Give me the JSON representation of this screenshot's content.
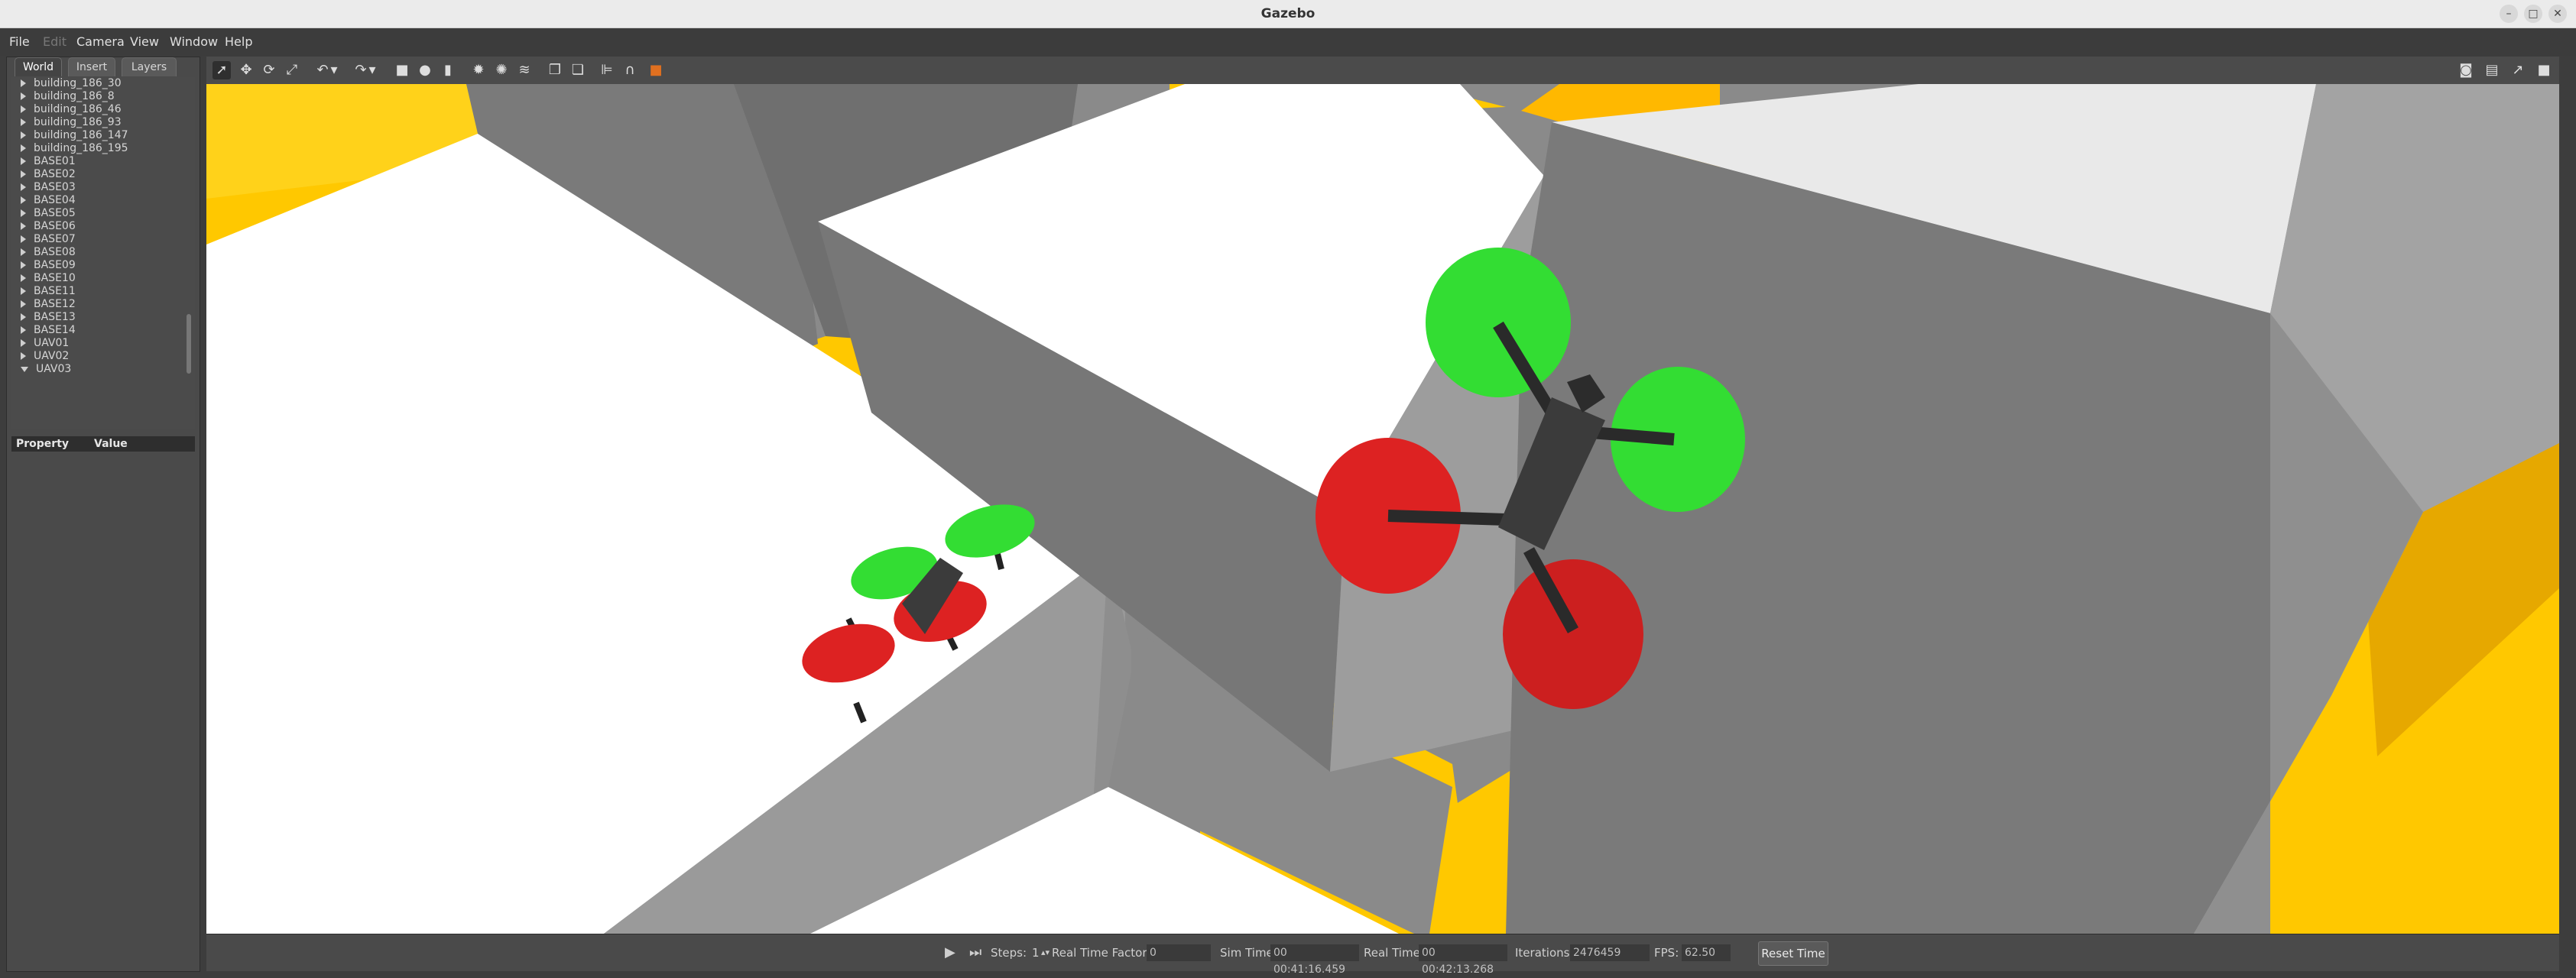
{
  "window": {
    "title": "Gazebo"
  },
  "menu": [
    {
      "label": "File",
      "enabled": true
    },
    {
      "label": "Edit",
      "enabled": false
    },
    {
      "label": "Camera",
      "enabled": true
    },
    {
      "label": "View",
      "enabled": true
    },
    {
      "label": "Window",
      "enabled": true
    },
    {
      "label": "Help",
      "enabled": true
    }
  ],
  "panel": {
    "tabs": [
      "World",
      "Insert",
      "Layers"
    ],
    "active_tab": "World",
    "tree": [
      "building_186_30",
      "building_186_8",
      "building_186_46",
      "building_186_93",
      "building_186_147",
      "building_186_195",
      "BASE01",
      "BASE02",
      "BASE03",
      "BASE04",
      "BASE05",
      "BASE06",
      "BASE07",
      "BASE08",
      "BASE09",
      "BASE10",
      "BASE11",
      "BASE12",
      "BASE13",
      "BASE14",
      "UAV01",
      "UAV02",
      "UAV03"
    ],
    "expanded": "UAV03",
    "property_header": {
      "property": "Property",
      "value": "Value"
    }
  },
  "toolbar": {
    "tools": [
      "select-arrow-icon",
      "translate-icon",
      "rotate-icon",
      "scale-icon",
      "undo-icon",
      "undo-dropdown-icon",
      "redo-icon",
      "redo-dropdown-icon",
      "box-icon",
      "sphere-icon",
      "cylinder-icon",
      "point-light-icon",
      "spot-light-icon",
      "directional-light-icon",
      "copy-icon",
      "paste-icon",
      "align-icon",
      "snap-icon",
      "change-view-icon"
    ],
    "right_tools": [
      "screenshot-icon",
      "log-icon",
      "plot-icon",
      "record-video-icon"
    ]
  },
  "status": {
    "steps_label": "Steps:",
    "steps_value": "1",
    "real_time_factor_label": "Real Time Factor:",
    "real_time_factor_value": "0",
    "sim_time_label": "Sim Time",
    "sim_time_value": "00 00:41:16.459",
    "real_time_label": "Real Time:",
    "real_time_value": "00 00:42:13.268",
    "iterations_label": "Iterations:",
    "iterations_value": "2476459",
    "fps_label": "FPS:",
    "fps_value": "62.50",
    "reset_label": "Reset Time"
  },
  "colors": {
    "ground": "#ffc800",
    "building_side": "#8a8a8a",
    "building_top": "#ffffff",
    "rotor_front": "#33dd33",
    "rotor_back": "#dd2222",
    "drone_body": "#3b3b3b"
  }
}
